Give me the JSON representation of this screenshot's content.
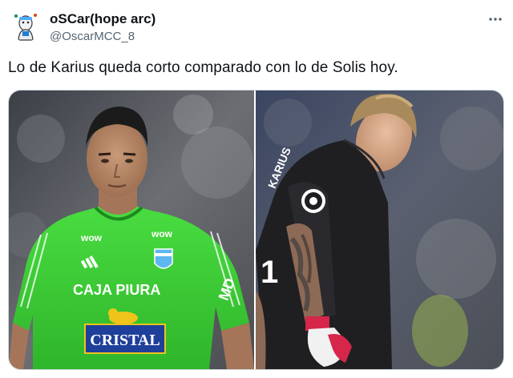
{
  "tweet": {
    "author_name": "oSCar(hope arc)",
    "author_handle": "@OscarMCC_8",
    "text": "Lo de Karius queda corto comparado con lo de Solis hoy."
  },
  "media": {
    "left_photo": {
      "jersey_sponsor": "CAJA PIURA",
      "jersey_sponsor_2": "CRISTAL",
      "jersey_brand": "wow",
      "jersey_badge": "MD"
    },
    "right_photo": {
      "shirt_name": "KARIUS",
      "sleeve_number": "1"
    }
  },
  "icons": {
    "avatar": "cartoon-avatar-icon",
    "more": "more-options-icon"
  },
  "colors": {
    "text": "#0f1419",
    "secondary": "#536471",
    "jersey_green": "#3fd03b",
    "jersey_dark": "#1f1f22"
  }
}
